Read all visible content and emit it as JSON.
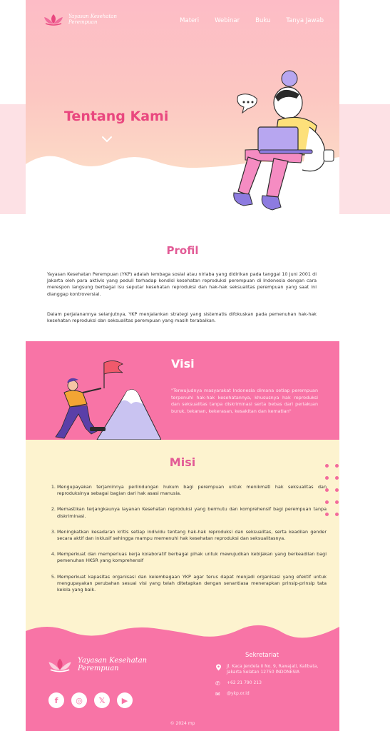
{
  "brand": {
    "name": "Yayasan Kesehatan Perempuan",
    "name_line1": "Yayasan Kesehatan",
    "name_line2": "Perempuan"
  },
  "nav": {
    "items": [
      {
        "label": "Materi"
      },
      {
        "label": "Webinar"
      },
      {
        "label": "Buku"
      },
      {
        "label": "Tanya Jawab"
      }
    ]
  },
  "hero": {
    "title": "Tentang Kami"
  },
  "profil": {
    "title": "Profil",
    "paragraphs": [
      "Yayasan Kesehatan Perempuan (YKP) adalah lembaga sosial atau nirlaba yang didirikan pada tanggal 10 Juni 2001 di Jakarta oleh para aktivis yang peduli terhadap kondisi kesehatan reproduksi perempuan di Indonesia dengan cara merespon langsung berbagai isu seputar kesehatan reproduksi dan hak-hak seksualitas perempuan yang saat ini dianggap kontroversial.",
      "Dalam perjalanannya selanjutnya, YKP menjalankan strategi yang sistematis difokuskan pada pemenuhan hak-hak kesehatan reproduksi dan seksualitas perempuan yang masih terabaikan."
    ]
  },
  "visi": {
    "title": "Visi",
    "text": "\"Terwujudnya masyarakat Indonesia dimana setiap perempuan terpenuhi hak-hak kesehatannya, khususnya hak reproduksi dan seksualitas tanpa diskriminasi serta bebas dari perlakuan buruk, tekanan, kekerasan, kesakitan dan kematian\""
  },
  "misi": {
    "title": "Misi",
    "items": [
      "Mengupayakan terjaminnya perlindungan hukum bagi perempuan untuk menikmati hak seksualitas dan reproduksinya sebagai bagian dari hak asasi manusia.",
      "Memastikan terjangkaunya layanan Kesehatan reproduksi yang bermutu dan komprehensif bagi perempuan tanpa diskriminasi.",
      "Meningkatkan kesadaran kritis setiap individu tentang hak-hak reproduksi dan seksualitas, serta keadilan gender secara aktif dan inklusif sehingga mampu memenuhi hak kesehatan reproduksi dan seksualitasnya.",
      "Memperkuat dan memperluas kerja kolaboratif berbagai pihak untuk mewujudkan kebijakan yang berkeadilan bagi pemenuhan HKSR yang komprehensif",
      "Memperkuat kapasitas organisasi dan kelembagaan YKP agar terus dapat menjadi organisasi yang efektif untuk mengupayakan perubahan sesuai visi yang telah ditetapkan dengan senantiasa menerapkan prinsip-prinsip tata kelola yang baik."
    ]
  },
  "footer": {
    "sekretariat_title": "Sekretariat",
    "address": "Jl. Kaca Jendela II No. 9, Rawajati, Kalibata, Jakarta Selatan 12750 INDONESIA",
    "phone": "+62 21 790 213",
    "email": "@ykp.or.id",
    "social": [
      {
        "icon": "facebook-icon",
        "glyph": "f"
      },
      {
        "icon": "instagram-icon",
        "glyph": "◎"
      },
      {
        "icon": "x-icon",
        "glyph": "𝕏"
      },
      {
        "icon": "youtube-icon",
        "glyph": "▶"
      }
    ],
    "copyright": "2024 mp"
  },
  "colors": {
    "pink": "#f874a6",
    "title_pink": "#e9477f",
    "cream": "#fdf3cf",
    "hero_top": "#fdbcc6"
  }
}
